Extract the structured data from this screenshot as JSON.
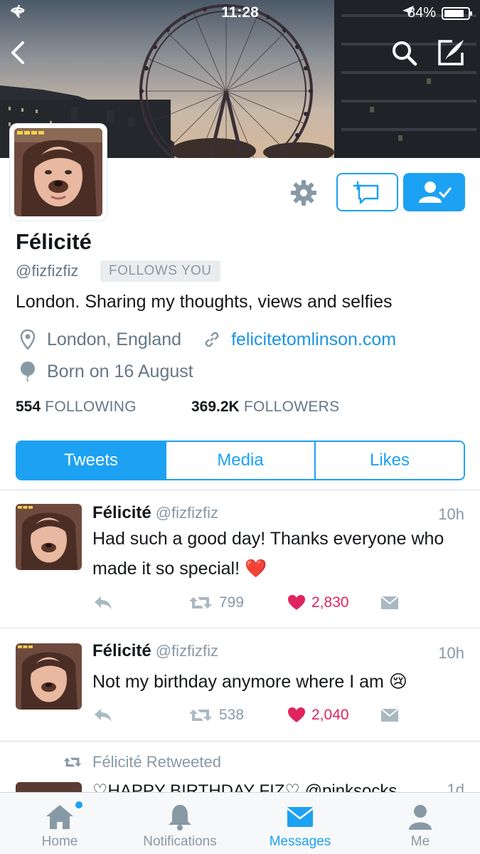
{
  "status_bar": {
    "time": "11:28",
    "battery_percent": "84%",
    "battery_level": 0.84
  },
  "nav": {
    "back_icon": "back-arrow-icon",
    "search_icon": "search-icon",
    "compose_icon": "compose-icon"
  },
  "profile": {
    "name": "Félicité",
    "handle": "@fizfizfiz",
    "follows_you": "FOLLOWS YOU",
    "bio": "London. Sharing my thoughts, views and selfies",
    "location": "London, England",
    "website": "felicitetomlinson.com",
    "birthday": "Born on 16 August",
    "following_count": "554",
    "following_label": "FOLLOWING",
    "followers_count": "369.2K",
    "followers_label": "FOLLOWERS"
  },
  "tabs": [
    {
      "label": "Tweets",
      "active": true
    },
    {
      "label": "Media",
      "active": false
    },
    {
      "label": "Likes",
      "active": false
    }
  ],
  "tweets": [
    {
      "name": "Félicité",
      "handle": "@fizfizfiz",
      "time": "10h",
      "text": "Had such a good day! Thanks everyone who made it so special! ❤️",
      "retweets": "799",
      "likes": "2,830"
    },
    {
      "name": "Félicité",
      "handle": "@fizfizfiz",
      "time": "10h",
      "text": "Not my birthday anymore where I am 😢",
      "retweets": "538",
      "likes": "2,040"
    }
  ],
  "retweeted": {
    "label": "Félicité Retweeted",
    "partial_text": "♡HAPPY BIRTHDAY FIZ♡ @pinksocks",
    "partial_time": "1d"
  },
  "tabbar": [
    {
      "label": "Home",
      "icon": "home-icon",
      "active": false,
      "badge": true
    },
    {
      "label": "Notifications",
      "icon": "bell-icon",
      "active": false,
      "badge": false
    },
    {
      "label": "Messages",
      "icon": "envelope-icon",
      "active": true,
      "badge": false
    },
    {
      "label": "Me",
      "icon": "person-icon",
      "active": false,
      "badge": false
    }
  ],
  "colors": {
    "accent": "#1da1f2",
    "like": "#e0245e",
    "muted": "#8899a6"
  }
}
